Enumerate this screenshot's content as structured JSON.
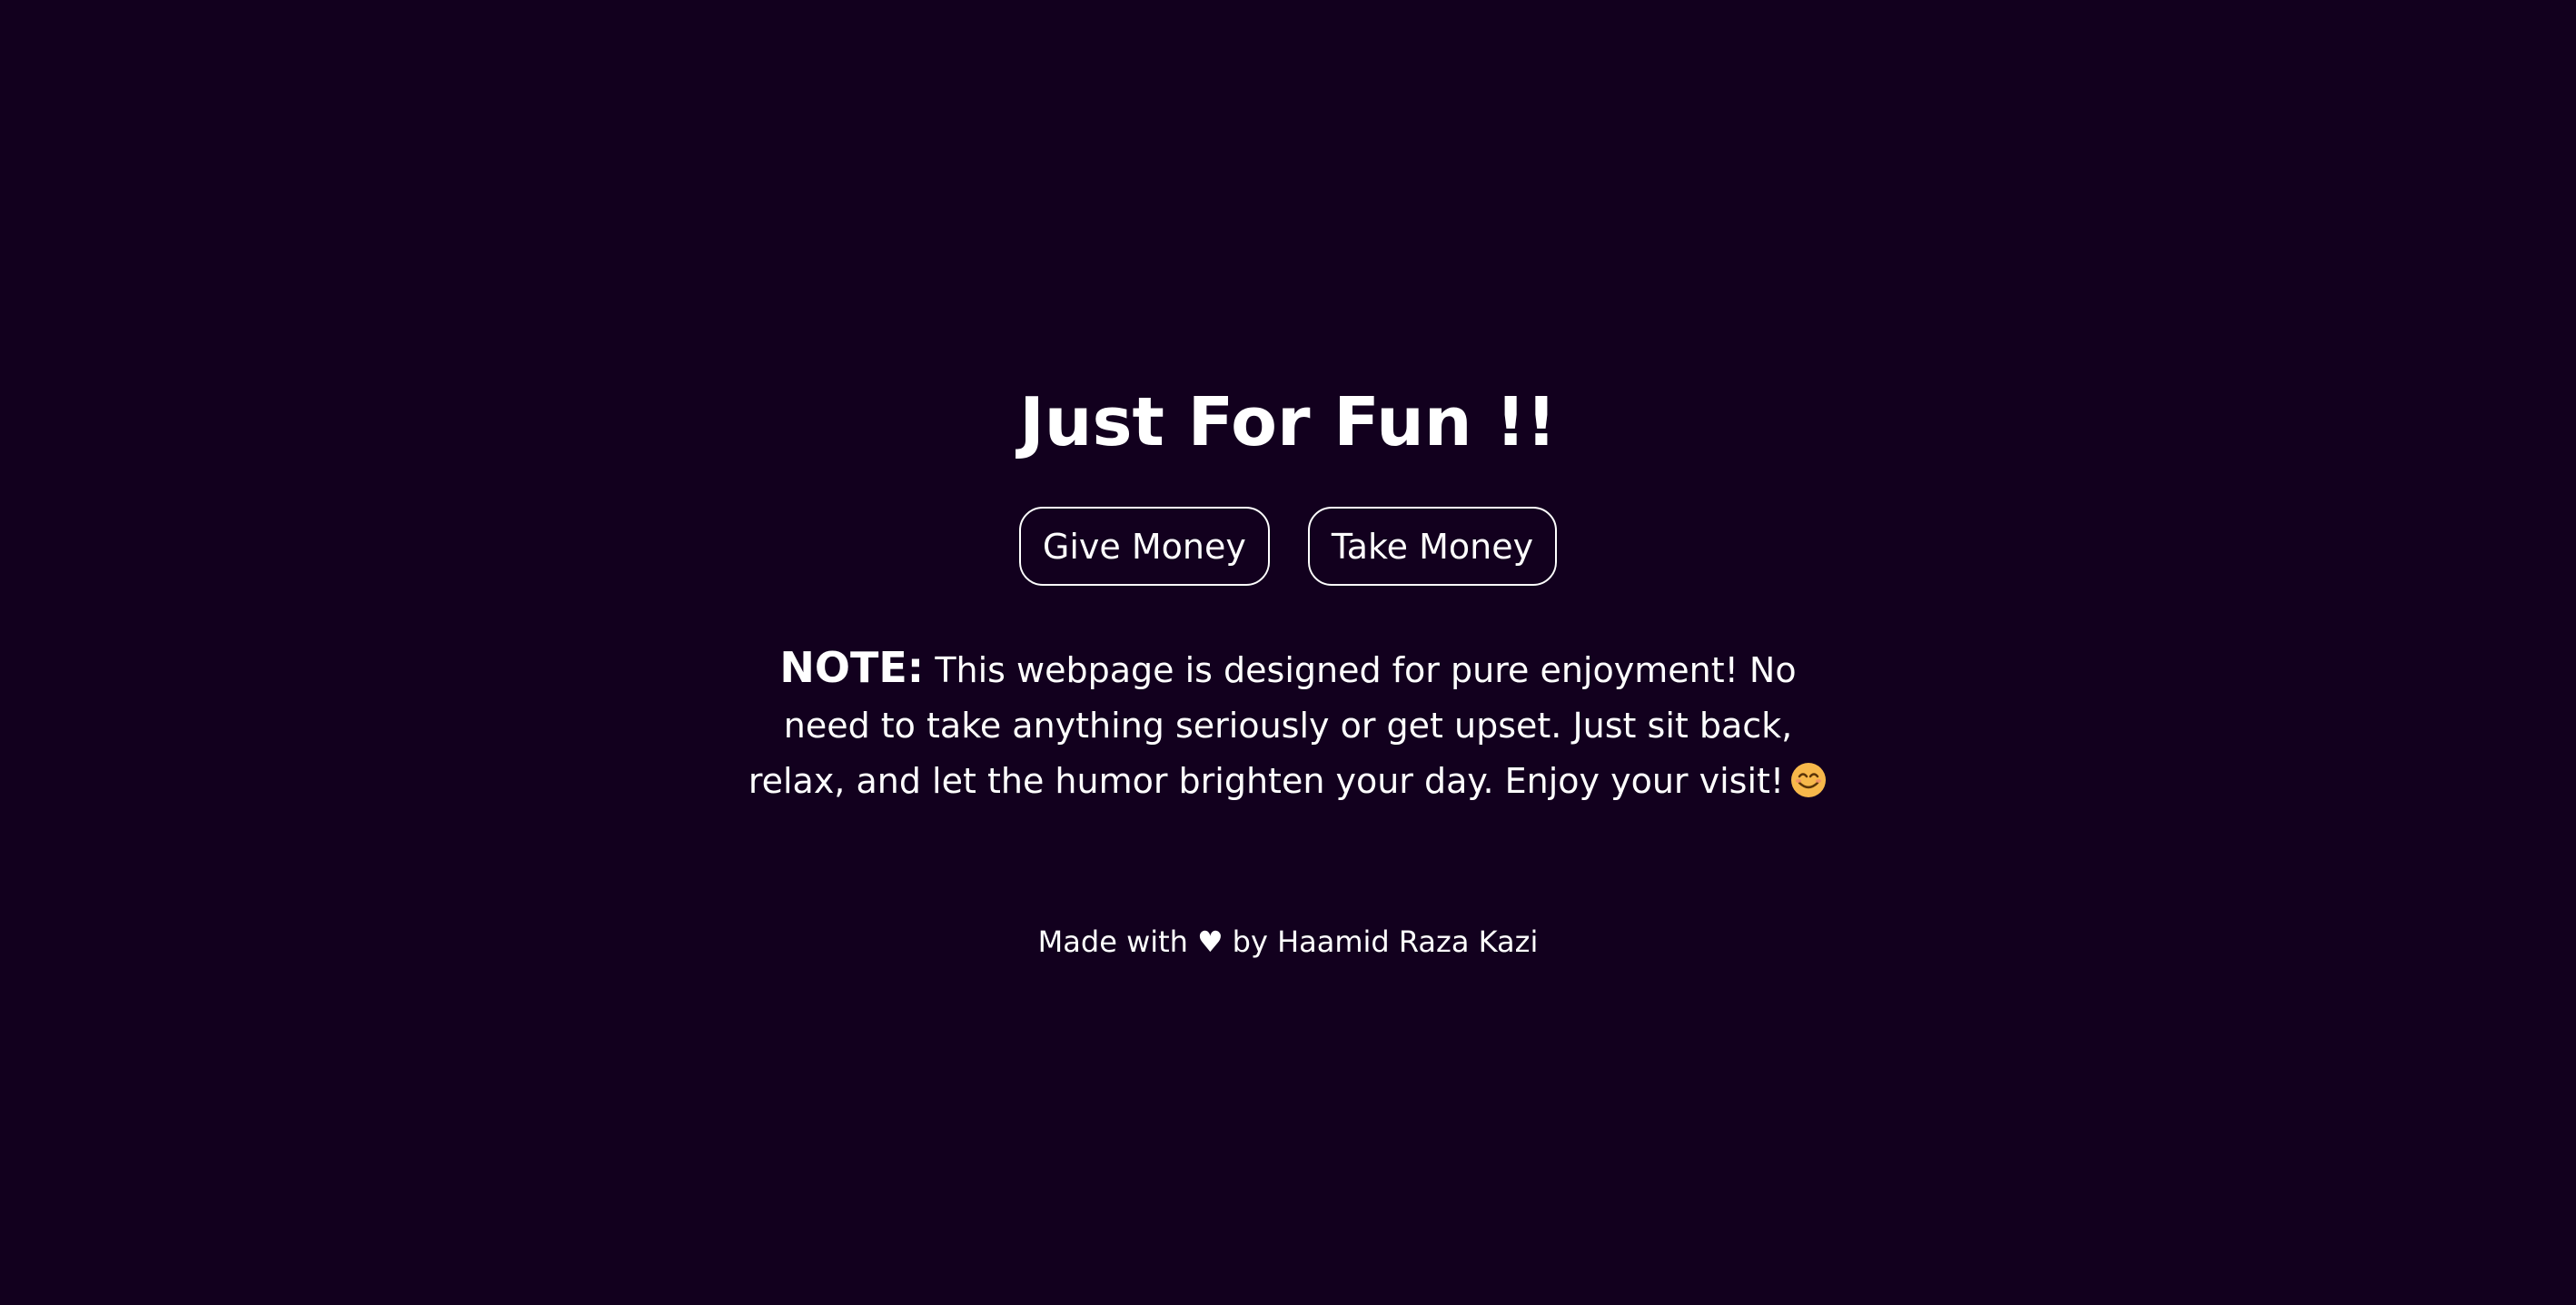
{
  "page": {
    "title": "Just For Fun !!"
  },
  "buttons": {
    "give_label": "Give Money",
    "take_label": "Take Money"
  },
  "note": {
    "label": "NOTE:",
    "text": "This webpage is designed for pure enjoyment! No need to take anything seriously or get upset. Just sit back, relax, and let the humor brighten your day. Enjoy your visit!",
    "emoji_icon": "smiling-face-icon"
  },
  "footer": {
    "prefix": "Made with",
    "heart": "♥",
    "suffix": "by Haamid Raza Kazi"
  },
  "colors": {
    "background": "#12001e",
    "text": "#ffffff",
    "emoji_face": "#f7b84b"
  }
}
